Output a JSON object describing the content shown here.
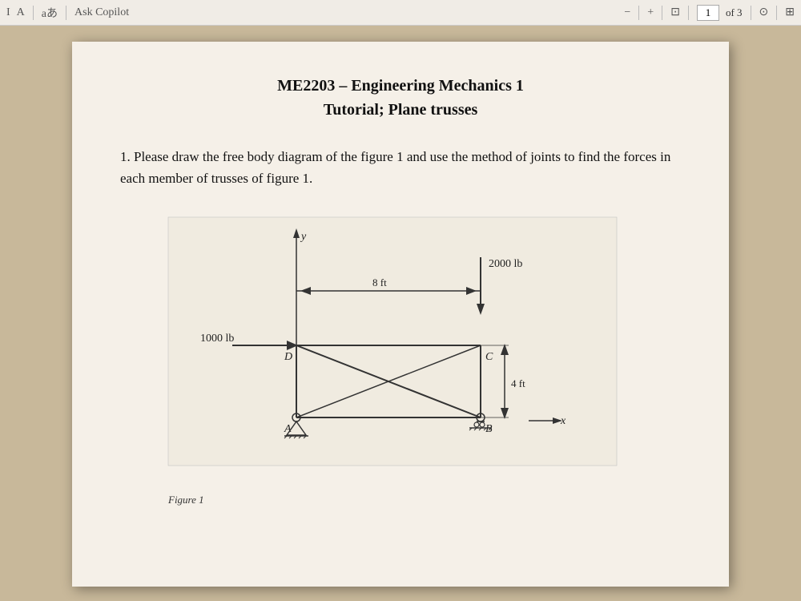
{
  "toolbar": {
    "font_icon": "I",
    "text_icon": "A",
    "aa_label": "aあ",
    "ask_copilot": "Ask Copilot",
    "minus_label": "−",
    "plus_label": "+",
    "fit_icon": "⊡",
    "page_current": "1",
    "page_of": "of 3",
    "search_icon": "⊙",
    "separator": "|",
    "copy_icon": "⊞"
  },
  "document": {
    "title_line1": "ME2203 – Engineering Mechanics 1",
    "title_line2": "Tutorial; Plane trusses",
    "question": "1. Please draw the free body diagram of the figure 1 and use the method of joints to find the forces in each member of trusses of figure 1.",
    "figure_label": "Figure 1"
  },
  "figure": {
    "force_top": "2000 lb",
    "force_left": "1000 lb",
    "dim_horizontal": "8 ft",
    "dim_vertical": "4 ft",
    "label_y": "y",
    "label_x": "x",
    "label_A": "A",
    "label_B": "B",
    "label_C": "C",
    "label_D": "D"
  }
}
